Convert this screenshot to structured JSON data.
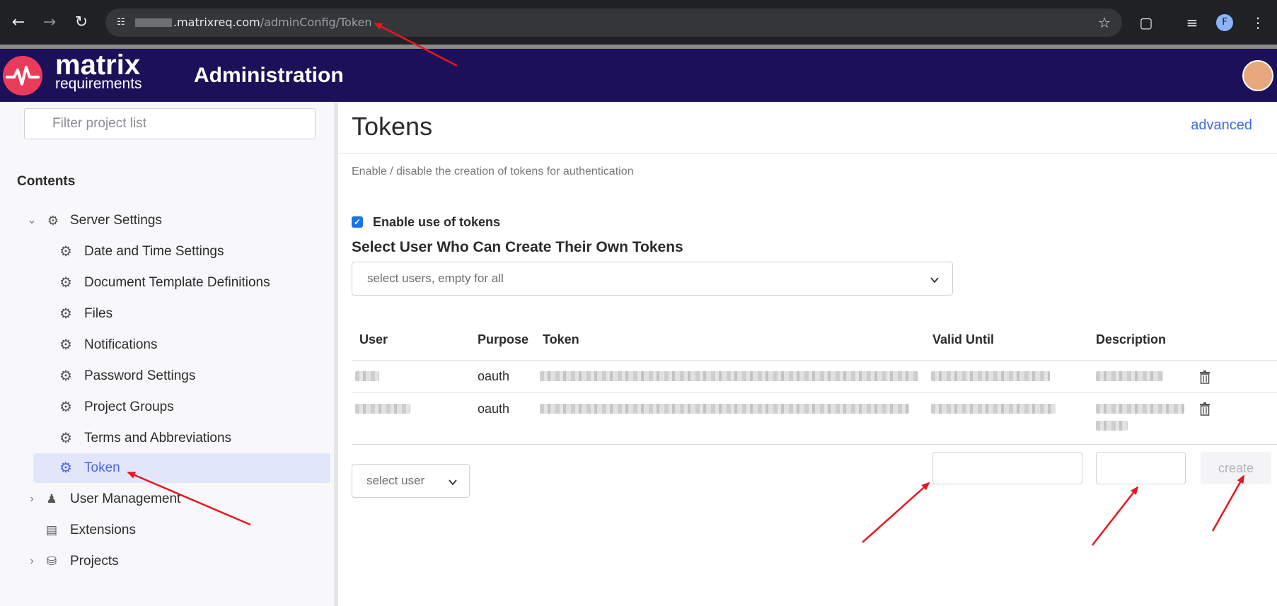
{
  "browser": {
    "url_host": ".matrixreq.com",
    "url_path": "/adminConfig/Token",
    "profile_initial": "F"
  },
  "app": {
    "logo_line1": "matrix",
    "logo_line2": "requirements",
    "title": "Administration"
  },
  "sidebar": {
    "filter_placeholder": "Filter project list",
    "contents_label": "Contents",
    "items": [
      {
        "label": "Server Settings",
        "icon": "server-settings-icon",
        "expanded": true
      },
      {
        "label": "Date and Time Settings",
        "icon": "gear-icon"
      },
      {
        "label": "Document Template Definitions",
        "icon": "gear-icon"
      },
      {
        "label": "Files",
        "icon": "gear-icon"
      },
      {
        "label": "Notifications",
        "icon": "gear-icon"
      },
      {
        "label": "Password Settings",
        "icon": "gear-icon"
      },
      {
        "label": "Project Groups",
        "icon": "gear-icon"
      },
      {
        "label": "Terms and Abbreviations",
        "icon": "gear-icon"
      },
      {
        "label": "Token",
        "icon": "gear-icon",
        "active": true
      },
      {
        "label": "User Management",
        "icon": "users-icon",
        "expanded": false
      },
      {
        "label": "Extensions",
        "icon": "extensions-icon"
      },
      {
        "label": "Projects",
        "icon": "database-icon",
        "expanded": false
      }
    ]
  },
  "main": {
    "title": "Tokens",
    "advanced_link": "advanced",
    "description": "Enable / disable the creation of tokens for authentication",
    "enable_label": "Enable use of tokens",
    "enable_checked": true,
    "select_users_title": "Select User Who Can Create Their Own Tokens",
    "select_users_placeholder": "select users, empty for all",
    "table": {
      "headers": [
        "User",
        "Purpose",
        "Token",
        "Valid Until",
        "Description"
      ],
      "rows": [
        {
          "purpose": "oauth"
        },
        {
          "purpose": "oauth"
        }
      ]
    },
    "new_token": {
      "select_user_placeholder": "select user",
      "create_label": "create"
    }
  },
  "colors": {
    "header_bg": "#1c1159",
    "brand_red": "#ea3b5a",
    "active_item_bg": "#e2e6fb",
    "link_blue": "#3d6be0",
    "annotation_arrow": "#e8161f"
  }
}
